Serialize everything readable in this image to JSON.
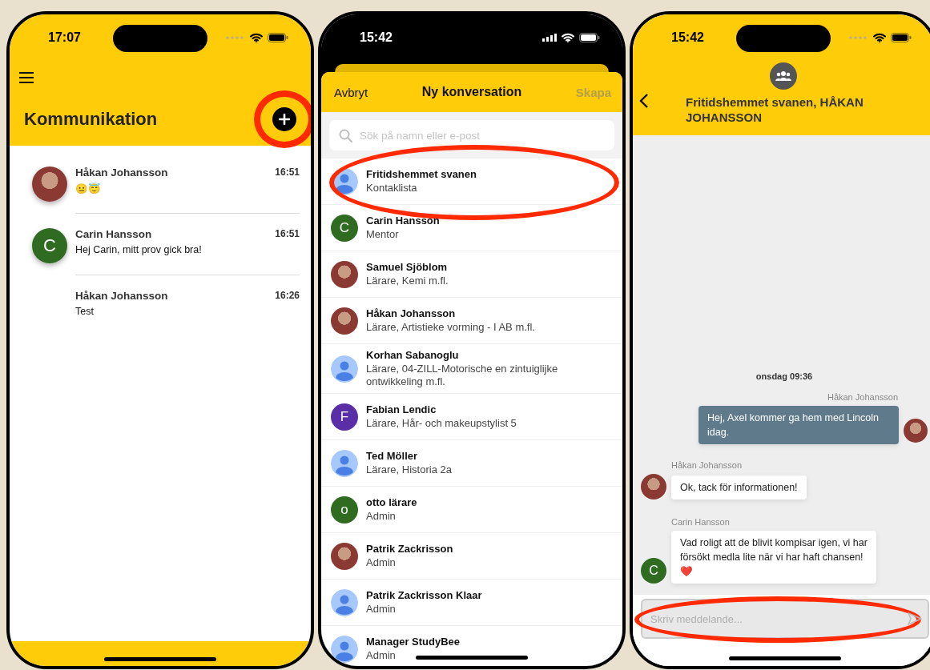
{
  "inbox": {
    "status_time": "17:07",
    "title": "Kommunikation",
    "add_button": {
      "highlighted": true
    },
    "conversations": [
      {
        "name": "Håkan Johansson",
        "preview": "😐😇",
        "time": "16:51",
        "avatar": {
          "kind": "photo"
        }
      },
      {
        "name": "Carin Hansson",
        "preview": "Hej Carin, mitt prov gick bra!",
        "time": "16:51",
        "avatar": {
          "kind": "letter",
          "letter": "C",
          "color": "#2f6b21"
        }
      },
      {
        "name": "Håkan Johansson",
        "preview": "Test",
        "time": "16:26",
        "avatar": {
          "kind": "none"
        }
      }
    ]
  },
  "new_conversation": {
    "status_time": "15:42",
    "cancel": "Avbryt",
    "title": "Ny konversation",
    "create": {
      "label": "Skapa",
      "disabled": true
    },
    "search": {
      "placeholder": "Sök på namn eller e-post"
    },
    "contacts": [
      {
        "name": "Fritidshemmet svanen",
        "role": "Kontaklista",
        "avatar": {
          "kind": "person"
        },
        "highlighted": true
      },
      {
        "name": "Carin Hansson",
        "role": "Mentor",
        "avatar": {
          "kind": "letter",
          "letter": "C",
          "color": "#2f6b21"
        },
        "highlighted": false
      },
      {
        "name": "Samuel Sjöblom",
        "role": "Lärare, Kemi m.fl.",
        "avatar": {
          "kind": "photo"
        },
        "highlighted": false
      },
      {
        "name": "Håkan Johansson",
        "role": "Lärare, Artistieke vorming - I AB m.fl.",
        "avatar": {
          "kind": "photo"
        },
        "highlighted": false
      },
      {
        "name": "Korhan Sabanoglu",
        "role": "Lärare, 04-ZILL-Motorische en zintuiglijke ontwikkeling m.fl.",
        "avatar": {
          "kind": "person"
        },
        "highlighted": false
      },
      {
        "name": "Fabian Lendic",
        "role": "Lärare, Hår- och makeupstylist 5",
        "avatar": {
          "kind": "letter",
          "letter": "F",
          "color": "#5a2ea6"
        },
        "highlighted": false
      },
      {
        "name": "Ted Möller",
        "role": "Lärare, Historia 2a",
        "avatar": {
          "kind": "person"
        },
        "highlighted": false
      },
      {
        "name": "otto lärare",
        "role": "Admin",
        "avatar": {
          "kind": "letter",
          "letter": "o",
          "color": "#2f6b21"
        },
        "highlighted": false
      },
      {
        "name": "Patrik Zackrisson",
        "role": "Admin",
        "avatar": {
          "kind": "photo"
        },
        "highlighted": false
      },
      {
        "name": "Patrik Zackrisson Klaar",
        "role": "Admin",
        "avatar": {
          "kind": "person"
        },
        "highlighted": false
      },
      {
        "name": "Manager StudyBee",
        "role": "Admin",
        "avatar": {
          "kind": "person"
        },
        "highlighted": false
      }
    ]
  },
  "chat": {
    "status_time": "15:42",
    "title": "Fritidshemmet svanen, HÅKAN JOHANSSON",
    "date": "onsdag 09:36",
    "messages": [
      {
        "kind": "outgoing",
        "sender": "Håkan Johansson",
        "text": "Hej, Axel kommer ga hem med Lincoln idag.",
        "avatar": {
          "kind": "photo"
        }
      },
      {
        "kind": "incoming",
        "sender": "Håkan Johansson",
        "text": "Ok, tack för informationen!",
        "avatar": {
          "kind": "photo"
        }
      },
      {
        "kind": "incoming",
        "sender": "Carin Hansson",
        "text": "Vad roligt att de blivit kompisar igen, vi har försökt medla lite när vi har haft chansen! ❤️",
        "avatar": {
          "kind": "letter",
          "letter": "C",
          "color": "#2f6b21"
        }
      }
    ],
    "message_field": {
      "placeholder": "Skriv meddelande...",
      "highlighted": true
    }
  }
}
